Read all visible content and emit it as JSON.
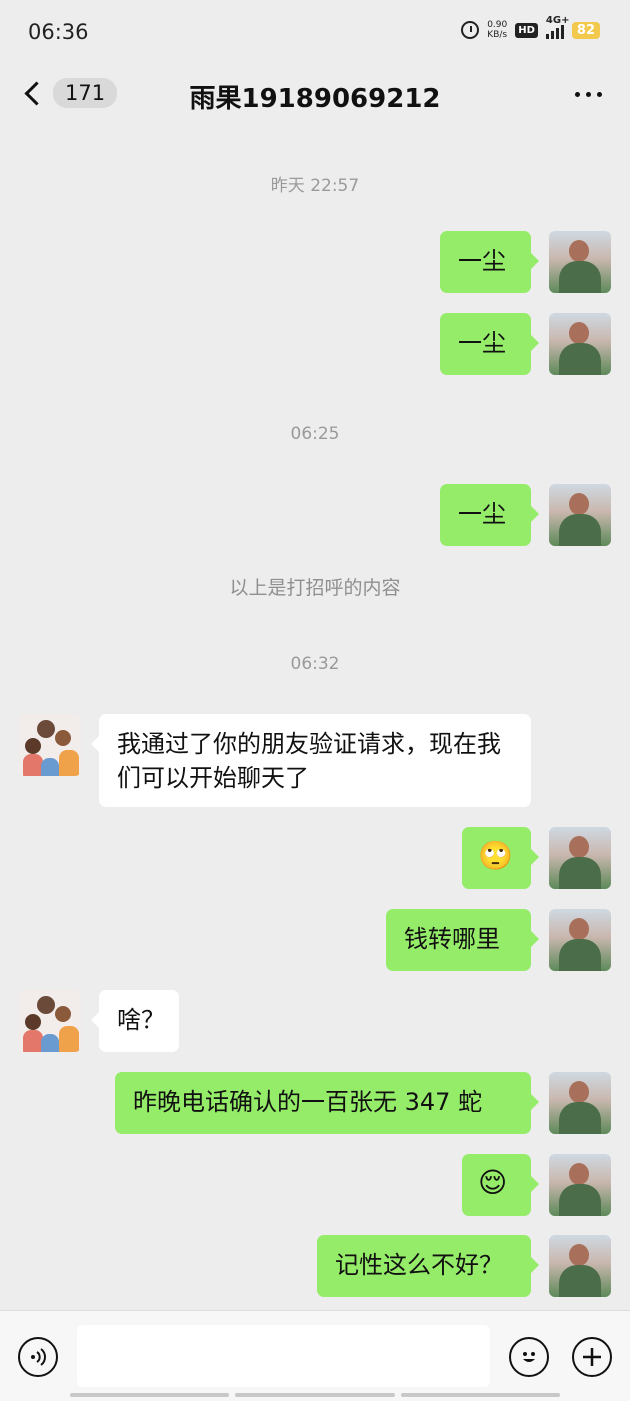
{
  "status": {
    "time": "06:36",
    "net_speed_value": "0.90",
    "net_speed_unit": "KB/s",
    "hd_label": "HD",
    "network_label": "4G+",
    "battery": "82"
  },
  "header": {
    "unread_count": "171",
    "title": "雨果19189069212"
  },
  "timestamps": [
    "昨天 22:57",
    "06:25",
    "06:32"
  ],
  "system_notice": "以上是打招呼的内容",
  "messages": [
    {
      "from": "me",
      "text": "一尘"
    },
    {
      "from": "me",
      "text": "一尘"
    },
    {
      "from": "me",
      "text": "一尘"
    },
    {
      "from": "them",
      "text": "我通过了你的朋友验证请求，现在我们可以开始聊天了"
    },
    {
      "from": "me",
      "text": "🙄"
    },
    {
      "from": "me",
      "text": "钱转哪里"
    },
    {
      "from": "them",
      "text": "啥？"
    },
    {
      "from": "me",
      "text": "昨晚电话确认的一百张无 347 蛇"
    },
    {
      "from": "me",
      "text": "😌"
    },
    {
      "from": "me",
      "text": "记性这么不好？"
    }
  ],
  "input": {
    "value": "",
    "placeholder": ""
  },
  "icons": {
    "back": "chevron-left-icon",
    "more": "more-dots-icon",
    "voice": "voice-icon",
    "emoji": "emoji-icon",
    "plus": "plus-icon"
  },
  "colors": {
    "background": "#ededed",
    "outgoing_bubble": "#95ec69",
    "incoming_bubble": "#ffffff",
    "battery": "#f2c94c"
  }
}
